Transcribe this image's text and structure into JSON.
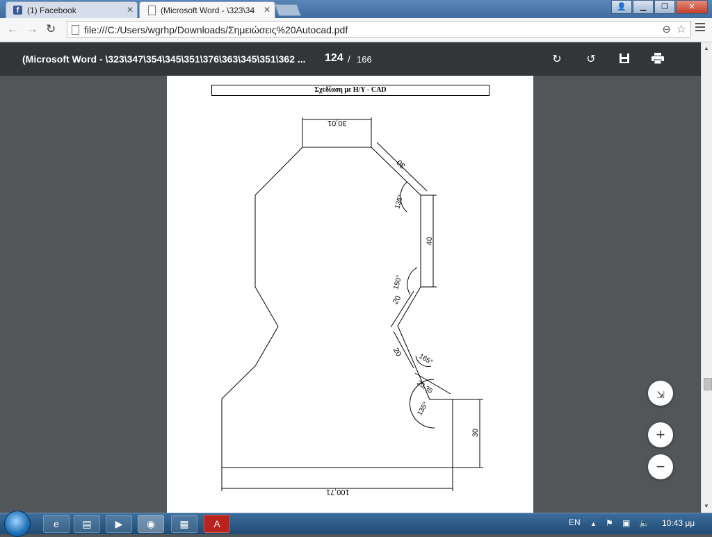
{
  "browser": {
    "tabs": [
      {
        "label": "(1) Facebook",
        "icon": "facebook-icon",
        "active": false
      },
      {
        "label": "(Microsoft Word - \\323\\34",
        "icon": "document-icon",
        "active": true
      }
    ],
    "url": "file:///C:/Users/wgrhp/Downloads/Σημειώσεις%20Autocad.pdf"
  },
  "pdf": {
    "title": "(Microsoft Word - \\323\\347\\354\\345\\351\\376\\363\\345\\351\\362 ...",
    "current_page": "124",
    "separator": "/",
    "total_pages": "166"
  },
  "document": {
    "header": "Σχεδίαση με Η/Υ - CAD",
    "dimensions": {
      "top_width": "30,01",
      "slant_upper": "30",
      "angle_upper": "135°",
      "vertical_right": "40",
      "angle_middle": "150°",
      "slant_middle": "20",
      "slant_lower": "20",
      "angle_lower": "165°",
      "slant_small": "20,35",
      "angle_bottom": "135°",
      "right_height": "30",
      "bottom_width": "100,71"
    }
  },
  "taskbar": {
    "language": "EN",
    "clock": "10:43 μμ"
  },
  "colors": {
    "pdf_toolbar": "#323639",
    "viewer_bg": "#525659",
    "taskbar": "#1f4a73"
  }
}
